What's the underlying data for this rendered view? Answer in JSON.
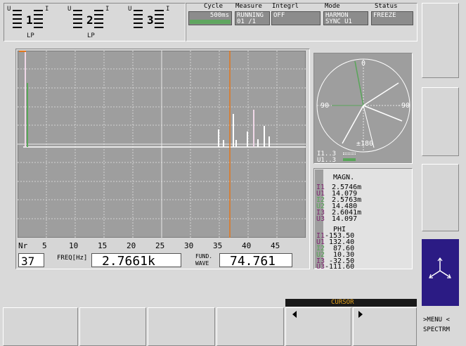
{
  "channels": [
    {
      "left_letter": "U",
      "right_letter": "I",
      "number": "1",
      "sub": "LP"
    },
    {
      "left_letter": "U",
      "right_letter": "I",
      "number": "2",
      "sub": "LP"
    },
    {
      "left_letter": "U",
      "right_letter": "I",
      "number": "3",
      "sub": "LP"
    }
  ],
  "status_header": {
    "cycle_label": "Cycle",
    "cycle_value": "500ms",
    "measure_label": "Measure",
    "measure_value": "RUNNING",
    "measure_sub": "01 /1",
    "integrl_label": "Integrl",
    "integrl_value": "OFF",
    "mode_label": "Mode",
    "mode_value": "HARMON",
    "mode_sub": "SYNC U1",
    "status_label": "Status",
    "status_value": "FREEZE"
  },
  "x_axis": {
    "prefix": "Nr",
    "ticks": [
      "5",
      "10",
      "15",
      "20",
      "25",
      "30",
      "35",
      "40",
      "45"
    ]
  },
  "readout": {
    "nr_value": "37",
    "freq_label": "FREQ[Hz]",
    "freq_value": "2.7661k",
    "fund_label_1": "FUND.",
    "fund_label_2": "WAVE",
    "fund_value": "74.761"
  },
  "phasor": {
    "label_0": "0",
    "label_90": "90",
    "label_m90": "-90",
    "label_180": "±180",
    "legend_i": "I1..3",
    "legend_u": "U1..3"
  },
  "magnitude": {
    "title": "MAGN.",
    "rows": [
      {
        "ch": "I1",
        "value": "2.5746m",
        "color": "#7e2670"
      },
      {
        "ch": "U1",
        "value": "14.079",
        "color": "#7e2670"
      },
      {
        "ch": "I2",
        "value": "2.5763m",
        "color": "#59a659"
      },
      {
        "ch": "U2",
        "value": "14.480",
        "color": "#59a659"
      },
      {
        "ch": "I3",
        "value": "2.6041m",
        "color": "#7e2670"
      },
      {
        "ch": "U3",
        "value": "14.097",
        "color": "#7e2670"
      }
    ]
  },
  "phase": {
    "title": "PHI",
    "rows": [
      {
        "ch": "I1",
        "value": "-153.50",
        "color": "#7e2670"
      },
      {
        "ch": "U1",
        "value": "132.40",
        "color": "#7e2670"
      },
      {
        "ch": "I2",
        "value": "87.60",
        "color": "#59a659"
      },
      {
        "ch": "U2",
        "value": "10.30",
        "color": "#59a659"
      },
      {
        "ch": "I3",
        "value": "-32.50",
        "color": "#7e2670"
      },
      {
        "ch": "U3",
        "value": "-111.60",
        "color": "#7e2670"
      }
    ]
  },
  "bottom_bar": {
    "cursor_label": "CURSOR",
    "menu_line_1": ">MENU <",
    "menu_line_2": "SPECTRM"
  },
  "colors": {
    "plot_bg": "#9e9e9e",
    "trace": "#ffffff",
    "cursor": "#e4761b",
    "accent_green": "#59a659",
    "accent_purple": "#7e2670",
    "nav_blue": "#2b1b84"
  }
}
